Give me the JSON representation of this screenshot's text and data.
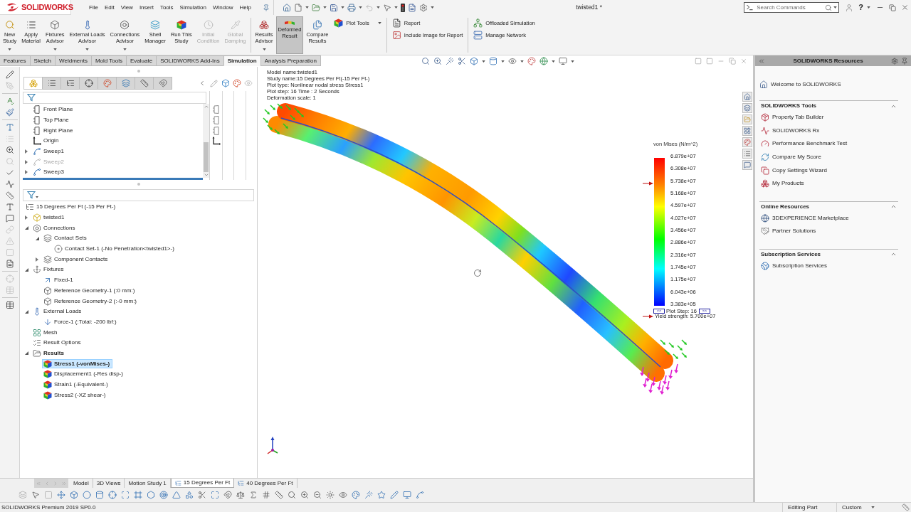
{
  "title_bar": {
    "logo": "SOLIDWORKS",
    "menus": [
      "File",
      "Edit",
      "View",
      "Insert",
      "Tools",
      "Simulation",
      "Window",
      "Help"
    ],
    "document": "twisted1 *",
    "search": {
      "placeholder": "Search Commands"
    },
    "help": "?"
  },
  "ribbon": [
    [
      {
        "label": "New Study",
        "kind": "large",
        "dropdown": true,
        "disabled": false,
        "selected": false
      },
      {
        "label": "Apply Material",
        "kind": "large",
        "dropdown": false,
        "disabled": false,
        "selected": false
      },
      {
        "label": "Fixtures Advisor",
        "kind": "large",
        "dropdown": true,
        "disabled": false,
        "selected": false
      },
      {
        "label": "External Loads Advisor",
        "kind": "large",
        "dropdown": true,
        "disabled": false,
        "selected": false
      },
      {
        "label": "Connections Advisor",
        "kind": "large",
        "dropdown": true,
        "disabled": false,
        "selected": false
      },
      {
        "label": "Shell Manager",
        "kind": "large",
        "dropdown": false,
        "disabled": false,
        "selected": false
      },
      {
        "label": "Run This Study",
        "kind": "large",
        "dropdown": false,
        "disabled": false,
        "selected": false
      },
      {
        "label": "Initial Condition",
        "kind": "large",
        "dropdown": false,
        "disabled": true,
        "selected": false
      },
      {
        "label": "Global Damping",
        "kind": "large",
        "dropdown": false,
        "disabled": true,
        "selected": false
      }
    ],
    [
      {
        "label": "Results Advisor",
        "kind": "large",
        "dropdown": true,
        "disabled": false,
        "selected": false
      },
      {
        "label": "Deformed Result",
        "kind": "large",
        "dropdown": false,
        "disabled": false,
        "selected": true
      },
      {
        "label": "Compare Results",
        "kind": "large",
        "dropdown": false,
        "disabled": false,
        "selected": false
      },
      {
        "label": "Plot Tools",
        "kind": "small",
        "dropdown": true,
        "disabled": false,
        "selected": false
      }
    ],
    [
      {
        "label": "Report",
        "kind": "small",
        "dropdown": false,
        "disabled": false,
        "selected": false
      },
      {
        "label": "Include Image for Report",
        "kind": "small",
        "dropdown": false,
        "disabled": false,
        "selected": false
      }
    ],
    [
      {
        "label": "Offloaded Simulation",
        "kind": "small",
        "dropdown": false,
        "disabled": false,
        "selected": false
      },
      {
        "label": "Manage Network",
        "kind": "small",
        "dropdown": false,
        "disabled": false,
        "selected": false
      }
    ]
  ],
  "command_tabs": [
    {
      "label": "Features",
      "selected": false
    },
    {
      "label": "Sketch",
      "selected": false
    },
    {
      "label": "Weldments",
      "selected": false
    },
    {
      "label": "Mold Tools",
      "selected": false
    },
    {
      "label": "Evaluate",
      "selected": false
    },
    {
      "label": "SOLIDWORKS Add-Ins",
      "selected": false
    },
    {
      "label": "Simulation",
      "selected": true
    },
    {
      "label": "Analysis Preparation",
      "selected": false
    }
  ],
  "panel_tabs": [
    {
      "selected": true
    },
    {
      "selected": false
    },
    {
      "selected": false
    },
    {
      "selected": false
    },
    {
      "selected": false
    },
    {
      "selected": false
    },
    {
      "selected": false
    },
    {
      "selected": false
    }
  ],
  "feature_tree": [
    {
      "label": "Front Plane",
      "kind": "plane",
      "suppressed": false
    },
    {
      "label": "Top Plane",
      "kind": "plane",
      "suppressed": false
    },
    {
      "label": "Right Plane",
      "kind": "plane",
      "suppressed": false
    },
    {
      "label": "Origin",
      "kind": "origin",
      "suppressed": false
    },
    {
      "label": "Sweep1",
      "kind": "sweep",
      "expanded": false,
      "suppressed": false
    },
    {
      "label": "Sweep2",
      "kind": "sweep",
      "expanded": false,
      "suppressed": true
    },
    {
      "label": "Sweep3",
      "kind": "sweep",
      "expanded": false,
      "suppressed": false
    }
  ],
  "simulation_tree": {
    "label": "15 Degrees Per Ft (-15 Per Ft-)",
    "kind": "study",
    "selected": false,
    "active": false,
    "children": [
      {
        "label": "twisted1",
        "kind": "part",
        "expanded": false,
        "selected": false,
        "active": false
      },
      {
        "label": "Connections",
        "kind": "connections",
        "expanded": true,
        "selected": false,
        "active": false,
        "children": [
          {
            "label": "Contact Sets",
            "kind": "contact-sets",
            "expanded": true,
            "selected": false,
            "active": false,
            "children": [
              {
                "label": "Contact Set-1 (-No Penetration<twisted1>-)",
                "kind": "contact",
                "selected": false,
                "active": false
              }
            ]
          },
          {
            "label": "Component Contacts",
            "kind": "contact-sets",
            "expanded": false,
            "selected": false,
            "active": false
          }
        ]
      },
      {
        "label": "Fixtures",
        "kind": "fixtures",
        "expanded": true,
        "selected": false,
        "active": false,
        "children": [
          {
            "label": "Fixed-1",
            "kind": "fixed",
            "selected": false,
            "active": false
          },
          {
            "label": "Reference Geometry-1 (:0 mm:)",
            "kind": "reference",
            "selected": false,
            "active": false
          },
          {
            "label": "Reference Geometry-2 (:-0 mm:)",
            "kind": "reference",
            "selected": false,
            "active": false
          }
        ]
      },
      {
        "label": "External Loads",
        "kind": "loads",
        "expanded": true,
        "selected": false,
        "active": false,
        "children": [
          {
            "label": "Force-1 (:Total: -200 lbf:)",
            "kind": "force",
            "selected": false,
            "active": false
          }
        ]
      },
      {
        "label": "Mesh",
        "kind": "mesh",
        "selected": false,
        "active": false
      },
      {
        "label": "Result Options",
        "kind": "options",
        "selected": false,
        "active": false
      },
      {
        "label": "Results",
        "kind": "results",
        "expanded": true,
        "selected": false,
        "active": true,
        "children": [
          {
            "label": "Stress1 (-vonMises-)",
            "kind": "plot",
            "selected": true,
            "active": true
          },
          {
            "label": "Displacement1 (-Res disp-)",
            "kind": "plot",
            "selected": false,
            "active": false
          },
          {
            "label": "Strain1 (-Equivalent-)",
            "kind": "plot",
            "selected": false,
            "active": false
          },
          {
            "label": "Stress2 (-XZ shear-)",
            "kind": "plot",
            "selected": false,
            "active": false
          }
        ]
      }
    ]
  },
  "plot_info": [
    "Model name:twisted1",
    "Study name:15 Degrees Per Ft(-15 Per Ft-)",
    "Plot type: Nonlinear nodal stress Stress1",
    "Plot step: 16 Time : 2 Seconds",
    "Deformation scale: 1"
  ],
  "legend": {
    "title": "von Mises (N/m^2)",
    "values": [
      "6.879e+07",
      "6.308e+07",
      "5.738e+07",
      "5.168e+07",
      "4.597e+07",
      "4.027e+07",
      "3.456e+07",
      "2.886e+07",
      "2.316e+07",
      "1.745e+07",
      "1.175e+07",
      "6.043e+06",
      "3.383e+05"
    ],
    "step_back": "<<",
    "step_label": "Plot Step: 16",
    "step_forward": ">>",
    "yield_strength": "Yield strength: 5.700e+07"
  },
  "bottom_tabs": [
    {
      "label": "Model",
      "kind": "plain",
      "selected": false
    },
    {
      "label": "3D Views",
      "kind": "plain",
      "selected": false
    },
    {
      "label": "Motion Study 1",
      "kind": "plain",
      "selected": false
    },
    {
      "label": "15 Degrees Per Ft",
      "kind": "study",
      "selected": true
    },
    {
      "label": "40 Degrees Per Ft",
      "kind": "study",
      "selected": false
    }
  ],
  "resources": {
    "title": "SOLIDWORKS Resources",
    "welcome": "Welcome to SOLIDWORKS",
    "sections": [
      {
        "title": "SOLIDWORKS Tools",
        "expanded": true,
        "items": [
          "Property Tab Builder",
          "SOLIDWORKS Rx",
          "Performance Benchmark Test",
          "Compare My Score",
          "Copy Settings Wizard",
          "My Products"
        ]
      },
      {
        "title": "Online Resources",
        "expanded": true,
        "items": [
          "3DEXPERIENCE Marketplace",
          "Partner Solutions"
        ]
      },
      {
        "title": "Subscription Services",
        "expanded": true,
        "items": [
          "Subscription Services"
        ]
      }
    ]
  },
  "status_bar": {
    "product": "SOLIDWORKS Premium 2019 SP0.0",
    "mode": "Editing Part",
    "units": "Custom"
  }
}
